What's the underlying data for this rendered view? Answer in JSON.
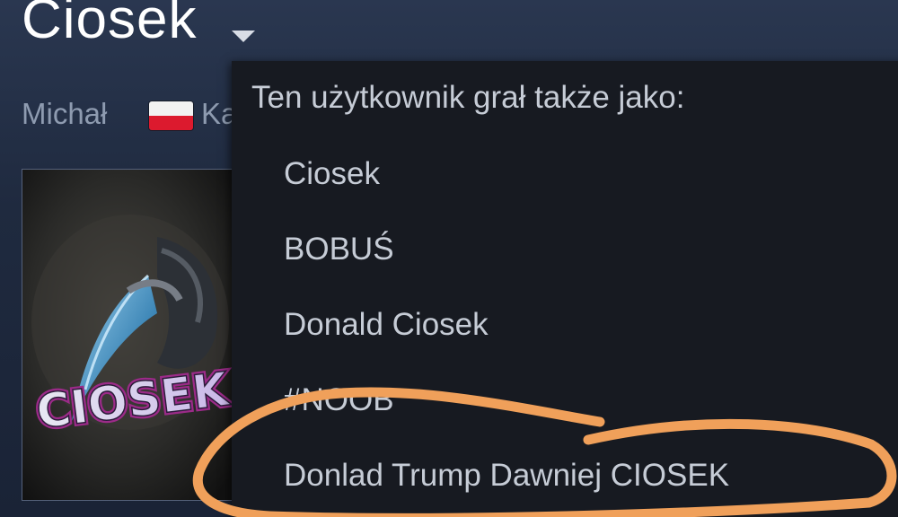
{
  "profile": {
    "persona_name": "Ciosek",
    "real_name": "Michał",
    "country_partial": "Ka"
  },
  "icons": {
    "dropdown_arrow": "chevron-down-icon",
    "flag": "poland-flag-icon"
  },
  "avatar": {
    "text": "CIOSEK"
  },
  "alias_dropdown": {
    "title": "Ten użytkownik grał także jako:",
    "aliases": [
      "Ciosek",
      "BOBUŚ",
      "Donald Ciosek",
      "#NOOB",
      "Donlad Trump Dawniej CIOSEK"
    ]
  },
  "colors": {
    "background": "#1f2a3d",
    "dropdown_bg": "#171a21",
    "text": "#c6ccd6",
    "annotation": "#f0a05a"
  }
}
